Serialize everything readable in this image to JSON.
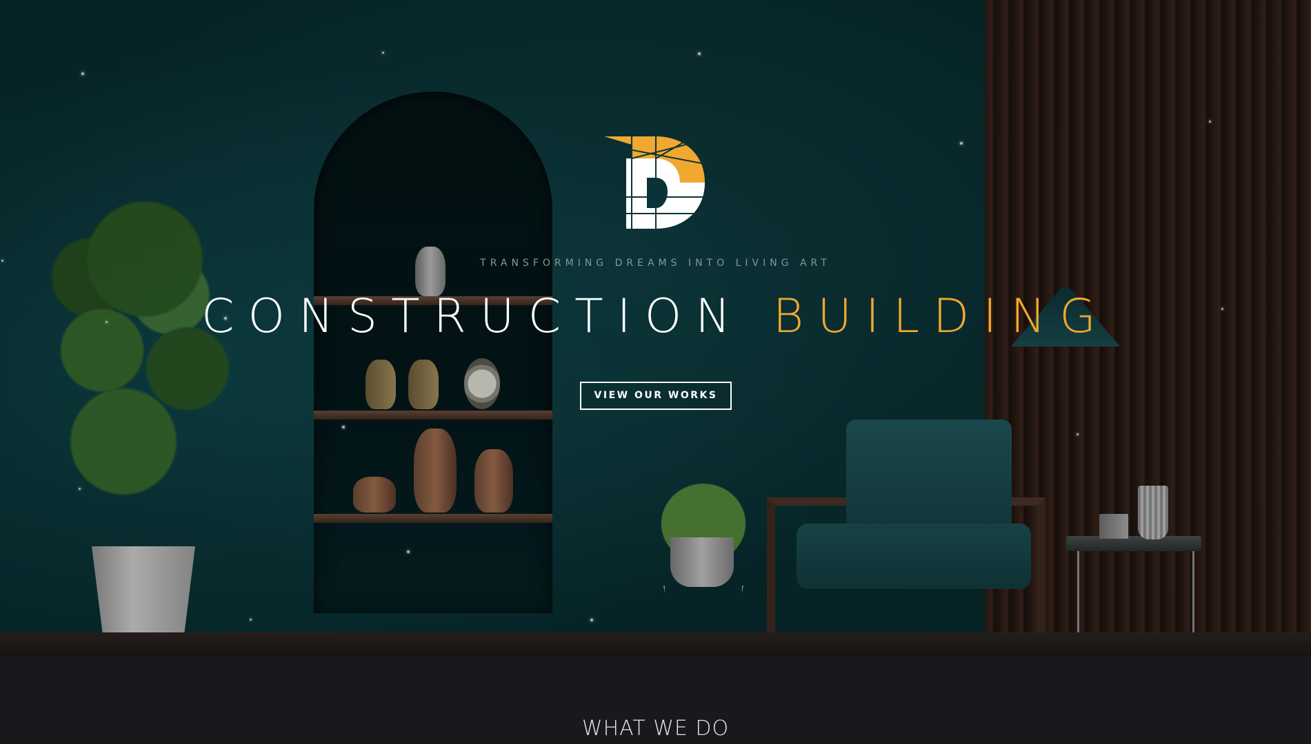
{
  "hero": {
    "tagline": "TRANSFORMING DREAMS INTO LIVING ART",
    "headline_main": "CONSTRUCTION",
    "headline_accent": "BUILDING",
    "cta_label": "VIEW OUR WORKS",
    "logo_icon": "d-monogram-logo"
  },
  "section": {
    "title": "WHAT WE DO"
  },
  "colors": {
    "accent": "#f0a830",
    "hero_bg": "#0b3236",
    "section_bg": "#17191c",
    "text": "#ffffff"
  }
}
